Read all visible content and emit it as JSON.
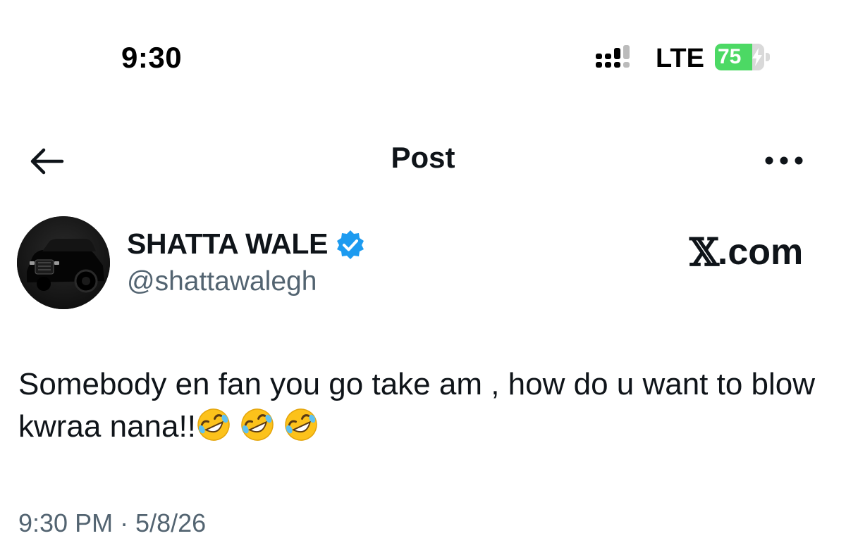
{
  "status_bar": {
    "time": "9:30",
    "network": "LTE",
    "battery_level": "75",
    "battery_fraction": 0.75,
    "icons": [
      "signal-bars-icon",
      "charging-bolt-icon"
    ]
  },
  "header": {
    "title": "Post",
    "icons": [
      "back-arrow-icon",
      "more-options-icon"
    ]
  },
  "post": {
    "author": {
      "display_name": "SHATTA WALE",
      "handle": "@shattawalegh",
      "verified": true,
      "verified_color": "#1d9bf0"
    },
    "watermark": {
      "logo": "𝕏",
      "suffix": ".com"
    },
    "text": "Somebody en fan you go take am , how do u want to blow kwraa nana!!",
    "emojis": [
      "rolling-on-floor-laughing-icon",
      "rolling-on-floor-laughing-icon",
      "rolling-on-floor-laughing-icon"
    ],
    "timestamp": "9:30 PM · 5/8/26"
  },
  "colors": {
    "text_primary": "#0f1419",
    "text_secondary": "#536471",
    "battery_green": "#4cd964"
  }
}
